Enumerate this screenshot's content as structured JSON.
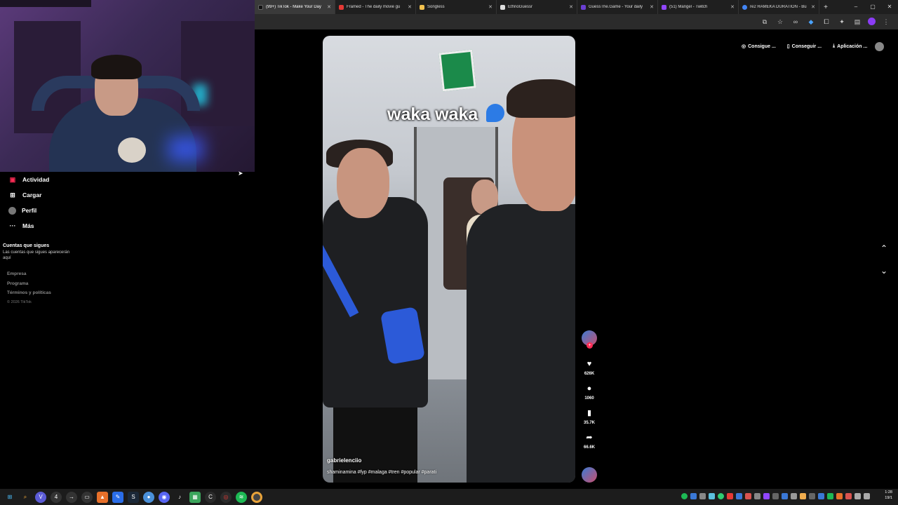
{
  "browser": {
    "tabs": [
      {
        "label": "(99+) TikTok - Make Your Day",
        "color": "#111111",
        "active": true
      },
      {
        "label": "Framed - The daily movie gu",
        "color": "#e53935",
        "active": false
      },
      {
        "label": "Songless",
        "color": "#f2c14e",
        "active": false
      },
      {
        "label": "EthnoGuessr",
        "color": "#dddddd",
        "active": false
      },
      {
        "label": "GuessThe.Game - Your daily",
        "color": "#6b3fd3",
        "active": false
      },
      {
        "label": "(51) Mangel - Twitch",
        "color": "#9146ff",
        "active": false
      },
      {
        "label": "re2 RAMEKA DURATION - Bu",
        "color": "#4285f4",
        "active": false
      }
    ],
    "new_tab": "+",
    "window_controls": [
      "–",
      "▢",
      "✕"
    ]
  },
  "sidebar": {
    "items": [
      {
        "label": "Actividad",
        "icon": "activity-icon"
      },
      {
        "label": "Cargar",
        "icon": "upload-icon"
      },
      {
        "label": "Perfil",
        "icon": "profile-icon"
      },
      {
        "label": "Más",
        "icon": "more-icon"
      }
    ],
    "following_title": "Cuentas que sigues",
    "following_desc": "Las cuentas que sigues aparecerán aquí",
    "footer": [
      "Empresa",
      "Programa",
      "Términos y políticas"
    ],
    "copyright": "© 2026 TikTok"
  },
  "video": {
    "caption": "waka waka",
    "username": "gabrielenciio",
    "hashtags": "shaminamina #fyp #malaga #tren #popular #parati"
  },
  "actions": {
    "likes": "626K",
    "comments": "1060",
    "saves": "35.7K",
    "shares": "66.6K"
  },
  "top_buttons": [
    {
      "label": "Consigue ...",
      "icon": "coin-icon"
    },
    {
      "label": "Conseguir ...",
      "icon": "phone-icon"
    },
    {
      "label": "Aplicación ...",
      "icon": "download-icon"
    }
  ],
  "taskbar": {
    "time": "1:28",
    "date": "19/1"
  }
}
